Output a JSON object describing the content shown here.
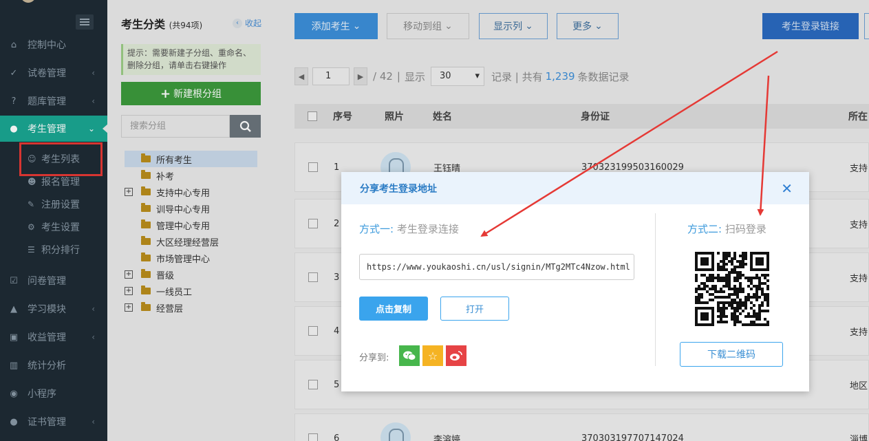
{
  "sidebar": {
    "items": [
      {
        "label": "控制中心",
        "icon": "home-icon"
      },
      {
        "label": "试卷管理",
        "icon": "check-circle-icon"
      },
      {
        "label": "题库管理",
        "icon": "question-icon"
      },
      {
        "label": "考生管理",
        "icon": "user-icon"
      },
      {
        "label": "问卷管理",
        "icon": "checkbox-icon"
      },
      {
        "label": "学习模块",
        "icon": "graduation-cap-icon"
      },
      {
        "label": "收益管理",
        "icon": "money-icon"
      },
      {
        "label": "统计分析",
        "icon": "bar-chart-icon"
      },
      {
        "label": "小程序",
        "icon": "wechat-icon"
      },
      {
        "label": "证书管理",
        "icon": "certificate-icon"
      }
    ],
    "subitems": [
      {
        "label": "考生列表"
      },
      {
        "label": "报名管理"
      },
      {
        "label": "注册设置"
      },
      {
        "label": "考生设置"
      },
      {
        "label": "积分排行"
      }
    ]
  },
  "group_panel": {
    "title": "考生分类",
    "count": "(共94项)",
    "collapse": "收起",
    "tip": "提示：需要新建子分组、重命名、删除分组，请单击右键操作",
    "new_root_button": "新建根分组",
    "search_placeholder": "搜索分组",
    "tree": [
      {
        "label": "所有考生",
        "expandable": false
      },
      {
        "label": "补考",
        "expandable": false
      },
      {
        "label": "支持中心专用",
        "expandable": true
      },
      {
        "label": "训导中心专用",
        "expandable": false
      },
      {
        "label": "管理中心专用",
        "expandable": false
      },
      {
        "label": "大区经理经营层",
        "expandable": false
      },
      {
        "label": "市场管理中心",
        "expandable": false
      },
      {
        "label": "晋级",
        "expandable": true
      },
      {
        "label": "一线员工",
        "expandable": true
      },
      {
        "label": "经营层",
        "expandable": true
      }
    ]
  },
  "toolbar": {
    "add_student": "添加考生",
    "move_to_group": "移动到组",
    "display_columns": "显示列",
    "more": "更多",
    "login_link": "考生登录链接"
  },
  "pager": {
    "page": "1",
    "total_pages": "/ 42",
    "show_label": "显示",
    "page_size": "30",
    "records_prefix": "记录 | 共有",
    "total_records": "1,239",
    "records_suffix": "条数据记录"
  },
  "table": {
    "headers": {
      "index": "序号",
      "photo": "照片",
      "name": "姓名",
      "id_card": "身份证",
      "location": "所在"
    },
    "rows": [
      {
        "index": "1",
        "name": "王钰晴",
        "id_card": "370323199503160029",
        "location": "支持"
      },
      {
        "index": "2",
        "name": "",
        "id_card": "",
        "location": "支持"
      },
      {
        "index": "3",
        "name": "",
        "id_card": "",
        "location": "支持"
      },
      {
        "index": "4",
        "name": "",
        "id_card": "",
        "location": "支持"
      },
      {
        "index": "5",
        "name": "",
        "id_card": "",
        "location": "地区"
      },
      {
        "index": "6",
        "name": "李溶婷",
        "id_card": "370303197707147024",
        "location": "淄博"
      }
    ]
  },
  "modal": {
    "title": "分享考生登录地址",
    "close_icon": "close-icon",
    "method1_prefix": "方式一:",
    "method1_text": "考生登录连接",
    "url": "https://www.youkaoshi.cn/usl/signin/MTg2MTc4Nzow.html",
    "copy_button": "点击复制",
    "open_button": "打开",
    "share_label": "分享到:",
    "share_icons": [
      "wechat-icon",
      "star-icon",
      "weibo-icon"
    ],
    "method2_prefix": "方式二:",
    "method2_text": "扫码登录",
    "download_qr_button": "下载二维码"
  },
  "colors": {
    "sidebar_bg": "#1e2b35",
    "sidebar_active": "#1aa692",
    "primary_blue": "#3c8fd9",
    "modal_accent": "#3aa4ed",
    "annotation_red": "#e53935"
  }
}
